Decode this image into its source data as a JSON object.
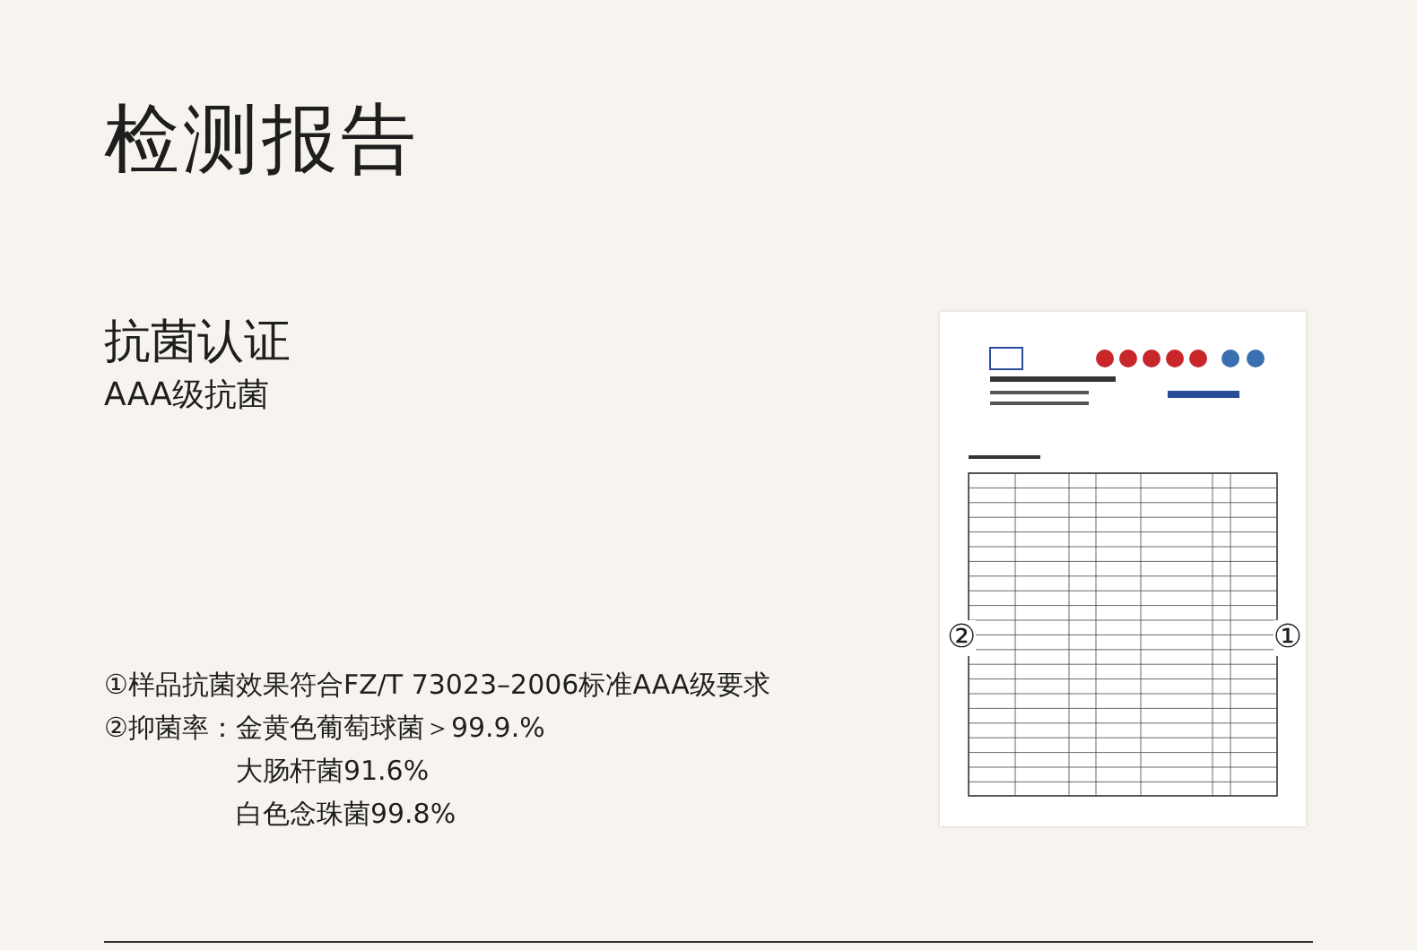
{
  "heading": "检测报告",
  "certification": {
    "title": "抗菌认证",
    "subtitle": "AAA级抗菌"
  },
  "standard_note": "①样品抗菌效果符合FZ/T 73023–2006标准AAA级要求",
  "inhibition": {
    "label": "②抑菌率：",
    "items": [
      "金黄色葡萄球菌＞99.9.%",
      "大肠杆菌91.6%",
      "白色念珠菌99.8%"
    ]
  },
  "report_markers": {
    "left": "②",
    "right": "①"
  }
}
